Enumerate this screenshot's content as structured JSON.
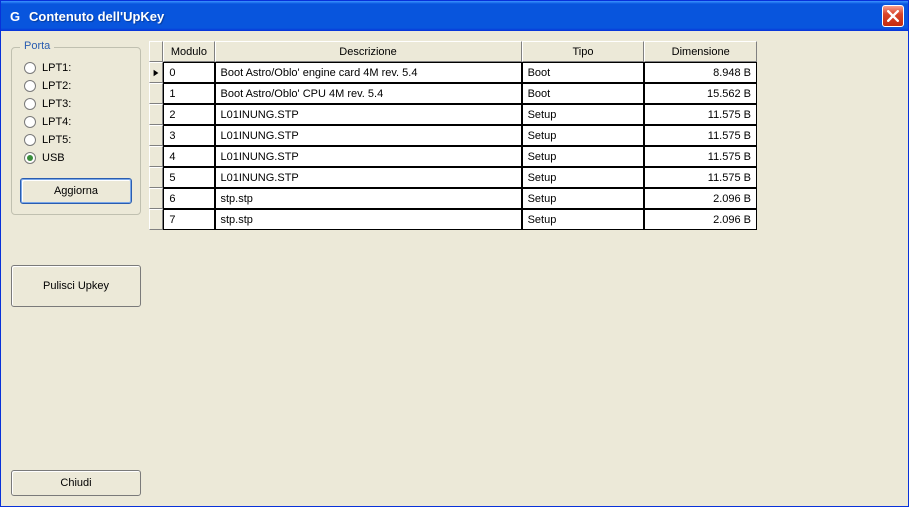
{
  "window": {
    "app_icon_letter": "G",
    "title": "Contenuto dell'UpKey"
  },
  "sidebar": {
    "group_label": "Porta",
    "ports": [
      {
        "label": "LPT1:",
        "checked": false
      },
      {
        "label": "LPT2:",
        "checked": false
      },
      {
        "label": "LPT3:",
        "checked": false
      },
      {
        "label": "LPT4:",
        "checked": false
      },
      {
        "label": "LPT5:",
        "checked": false
      },
      {
        "label": "USB",
        "checked": true
      }
    ],
    "refresh_label": "Aggiorna",
    "clean_label": "Pulisci Upkey",
    "close_label": "Chiudi"
  },
  "table": {
    "headers": {
      "modulo": "Modulo",
      "descrizione": "Descrizione",
      "tipo": "Tipo",
      "dimensione": "Dimensione"
    },
    "rows": [
      {
        "modulo": "0",
        "descrizione": "Boot Astro/Oblo' engine card 4M rev. 5.4",
        "tipo": "Boot",
        "dimensione": "8.948 B"
      },
      {
        "modulo": "1",
        "descrizione": "Boot Astro/Oblo' CPU 4M rev. 5.4",
        "tipo": "Boot",
        "dimensione": "15.562 B"
      },
      {
        "modulo": "2",
        "descrizione": "L01INUNG.STP",
        "tipo": "Setup",
        "dimensione": "11.575 B"
      },
      {
        "modulo": "3",
        "descrizione": "L01INUNG.STP",
        "tipo": "Setup",
        "dimensione": "11.575 B"
      },
      {
        "modulo": "4",
        "descrizione": "L01INUNG.STP",
        "tipo": "Setup",
        "dimensione": "11.575 B"
      },
      {
        "modulo": "5",
        "descrizione": "L01INUNG.STP",
        "tipo": "Setup",
        "dimensione": "11.575 B"
      },
      {
        "modulo": "6",
        "descrizione": "stp.stp",
        "tipo": "Setup",
        "dimensione": "2.096 B"
      },
      {
        "modulo": "7",
        "descrizione": "stp.stp",
        "tipo": "Setup",
        "dimensione": "2.096 B"
      }
    ],
    "selected_row_index": 0
  }
}
